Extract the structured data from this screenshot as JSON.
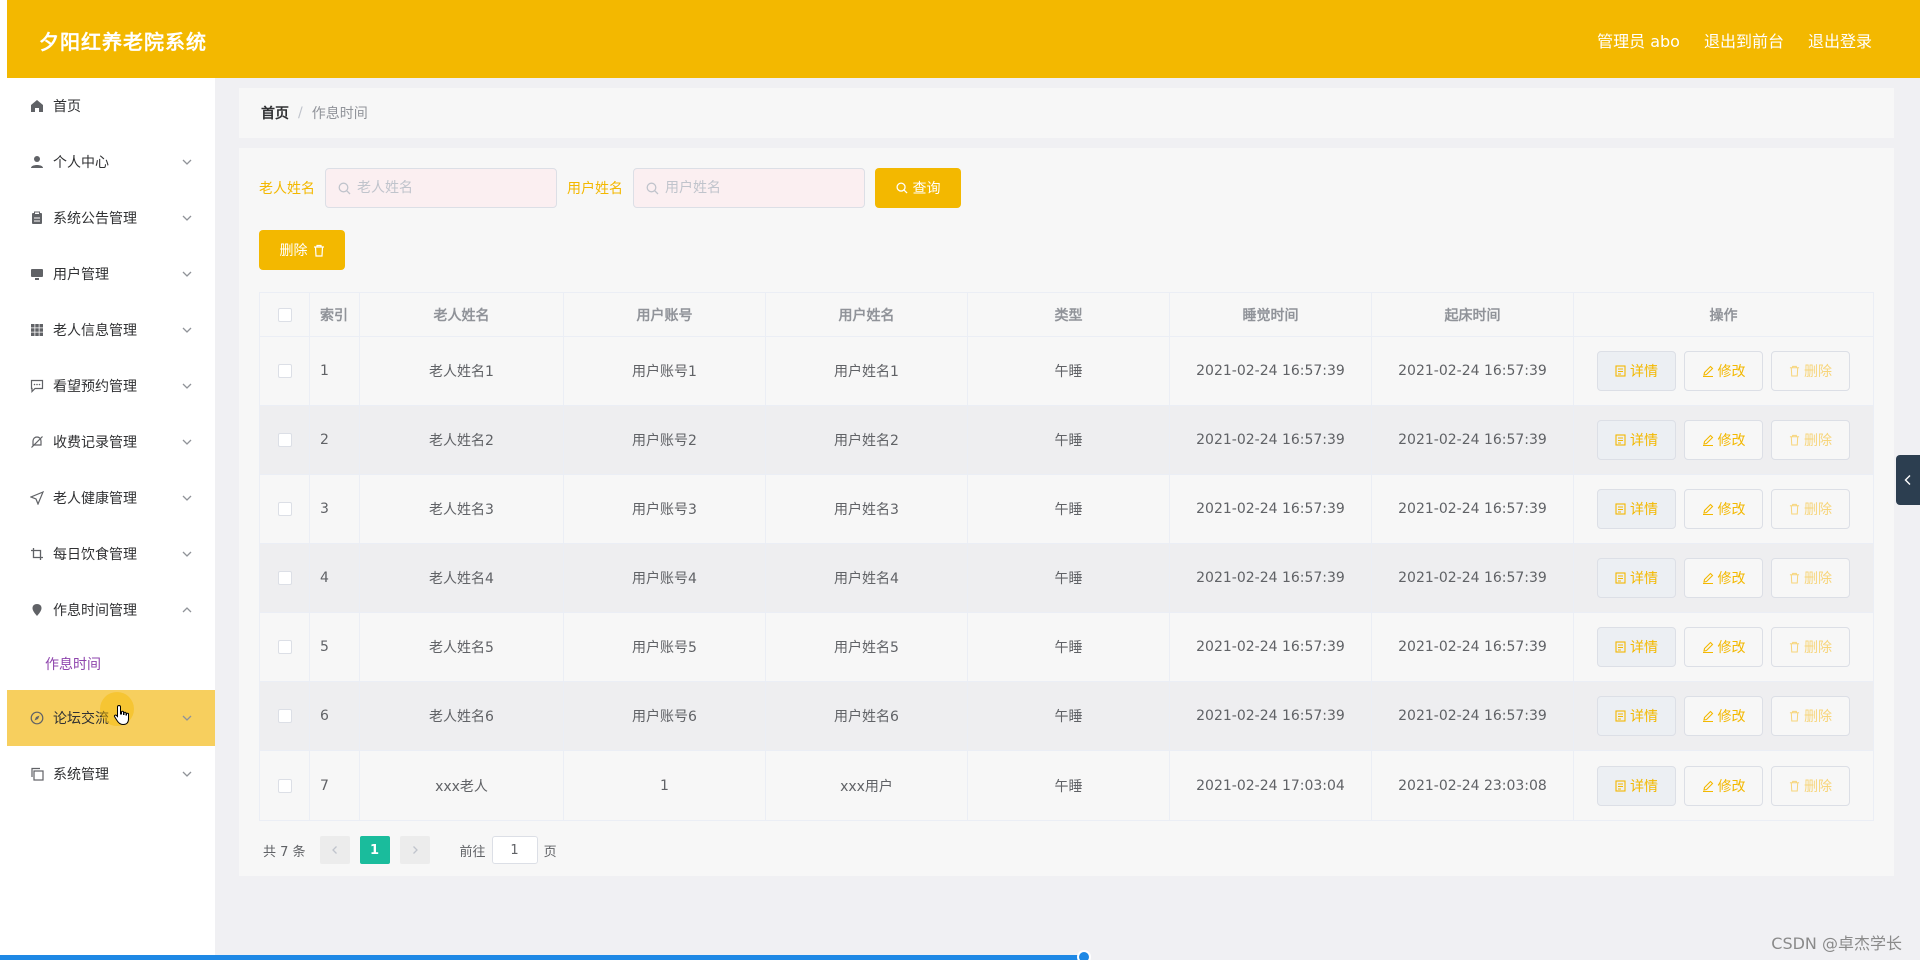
{
  "header": {
    "title": "夕阳红养老院系统",
    "admin": "管理员 abo",
    "to_front": "退出到前台",
    "logout": "退出登录"
  },
  "sidebar": {
    "items": [
      {
        "label": "首页",
        "icon": "home-icon"
      },
      {
        "label": "个人中心",
        "icon": "user-icon"
      },
      {
        "label": "系统公告管理",
        "icon": "clipboard-icon"
      },
      {
        "label": "用户管理",
        "icon": "monitor-icon"
      },
      {
        "label": "老人信息管理",
        "icon": "grid-icon"
      },
      {
        "label": "看望预约管理",
        "icon": "chat-icon"
      },
      {
        "label": "收费记录管理",
        "icon": "bell-off-icon"
      },
      {
        "label": "老人健康管理",
        "icon": "send-icon"
      },
      {
        "label": "每日饮食管理",
        "icon": "crop-icon"
      },
      {
        "label": "作息时间管理",
        "icon": "location-icon"
      },
      {
        "label": "论坛交流",
        "icon": "compass-icon"
      },
      {
        "label": "系统管理",
        "icon": "copy-icon"
      }
    ],
    "sub_item": "作息时间"
  },
  "breadcrumb": {
    "home": "首页",
    "separator": "/",
    "current": "作息时间"
  },
  "search": {
    "elder_label": "老人姓名",
    "elder_placeholder": "老人姓名",
    "user_label": "用户姓名",
    "user_placeholder": "用户姓名",
    "query_button": "查询"
  },
  "toolbar": {
    "delete_button": "删除"
  },
  "table": {
    "headers": [
      "索引",
      "老人姓名",
      "用户账号",
      "用户姓名",
      "类型",
      "睡觉时间",
      "起床时间",
      "操作"
    ],
    "rows": [
      {
        "idx": "1",
        "elder": "老人姓名1",
        "account": "用户账号1",
        "user": "用户姓名1",
        "type": "午睡",
        "sleep": "2021-02-24 16:57:39",
        "wake": "2021-02-24 16:57:39"
      },
      {
        "idx": "2",
        "elder": "老人姓名2",
        "account": "用户账号2",
        "user": "用户姓名2",
        "type": "午睡",
        "sleep": "2021-02-24 16:57:39",
        "wake": "2021-02-24 16:57:39"
      },
      {
        "idx": "3",
        "elder": "老人姓名3",
        "account": "用户账号3",
        "user": "用户姓名3",
        "type": "午睡",
        "sleep": "2021-02-24 16:57:39",
        "wake": "2021-02-24 16:57:39"
      },
      {
        "idx": "4",
        "elder": "老人姓名4",
        "account": "用户账号4",
        "user": "用户姓名4",
        "type": "午睡",
        "sleep": "2021-02-24 16:57:39",
        "wake": "2021-02-24 16:57:39"
      },
      {
        "idx": "5",
        "elder": "老人姓名5",
        "account": "用户账号5",
        "user": "用户姓名5",
        "type": "午睡",
        "sleep": "2021-02-24 16:57:39",
        "wake": "2021-02-24 16:57:39"
      },
      {
        "idx": "6",
        "elder": "老人姓名6",
        "account": "用户账号6",
        "user": "用户姓名6",
        "type": "午睡",
        "sleep": "2021-02-24 16:57:39",
        "wake": "2021-02-24 16:57:39"
      },
      {
        "idx": "7",
        "elder": "xxx老人",
        "account": "1",
        "user": "xxx用户",
        "type": "午睡",
        "sleep": "2021-02-24 17:03:04",
        "wake": "2021-02-24 23:03:08"
      }
    ],
    "actions": {
      "detail": "详情",
      "edit": "修改",
      "delete": "删除"
    }
  },
  "pagination": {
    "total": "共 7 条",
    "current_page": "1",
    "goto_prefix": "前往",
    "goto_value": "1",
    "goto_suffix": "页"
  },
  "watermark": "CSDN @卓杰学长",
  "colors": {
    "accent": "#f3b800",
    "page_active": "#1abc9c",
    "submenu_text": "#8e44ad"
  }
}
